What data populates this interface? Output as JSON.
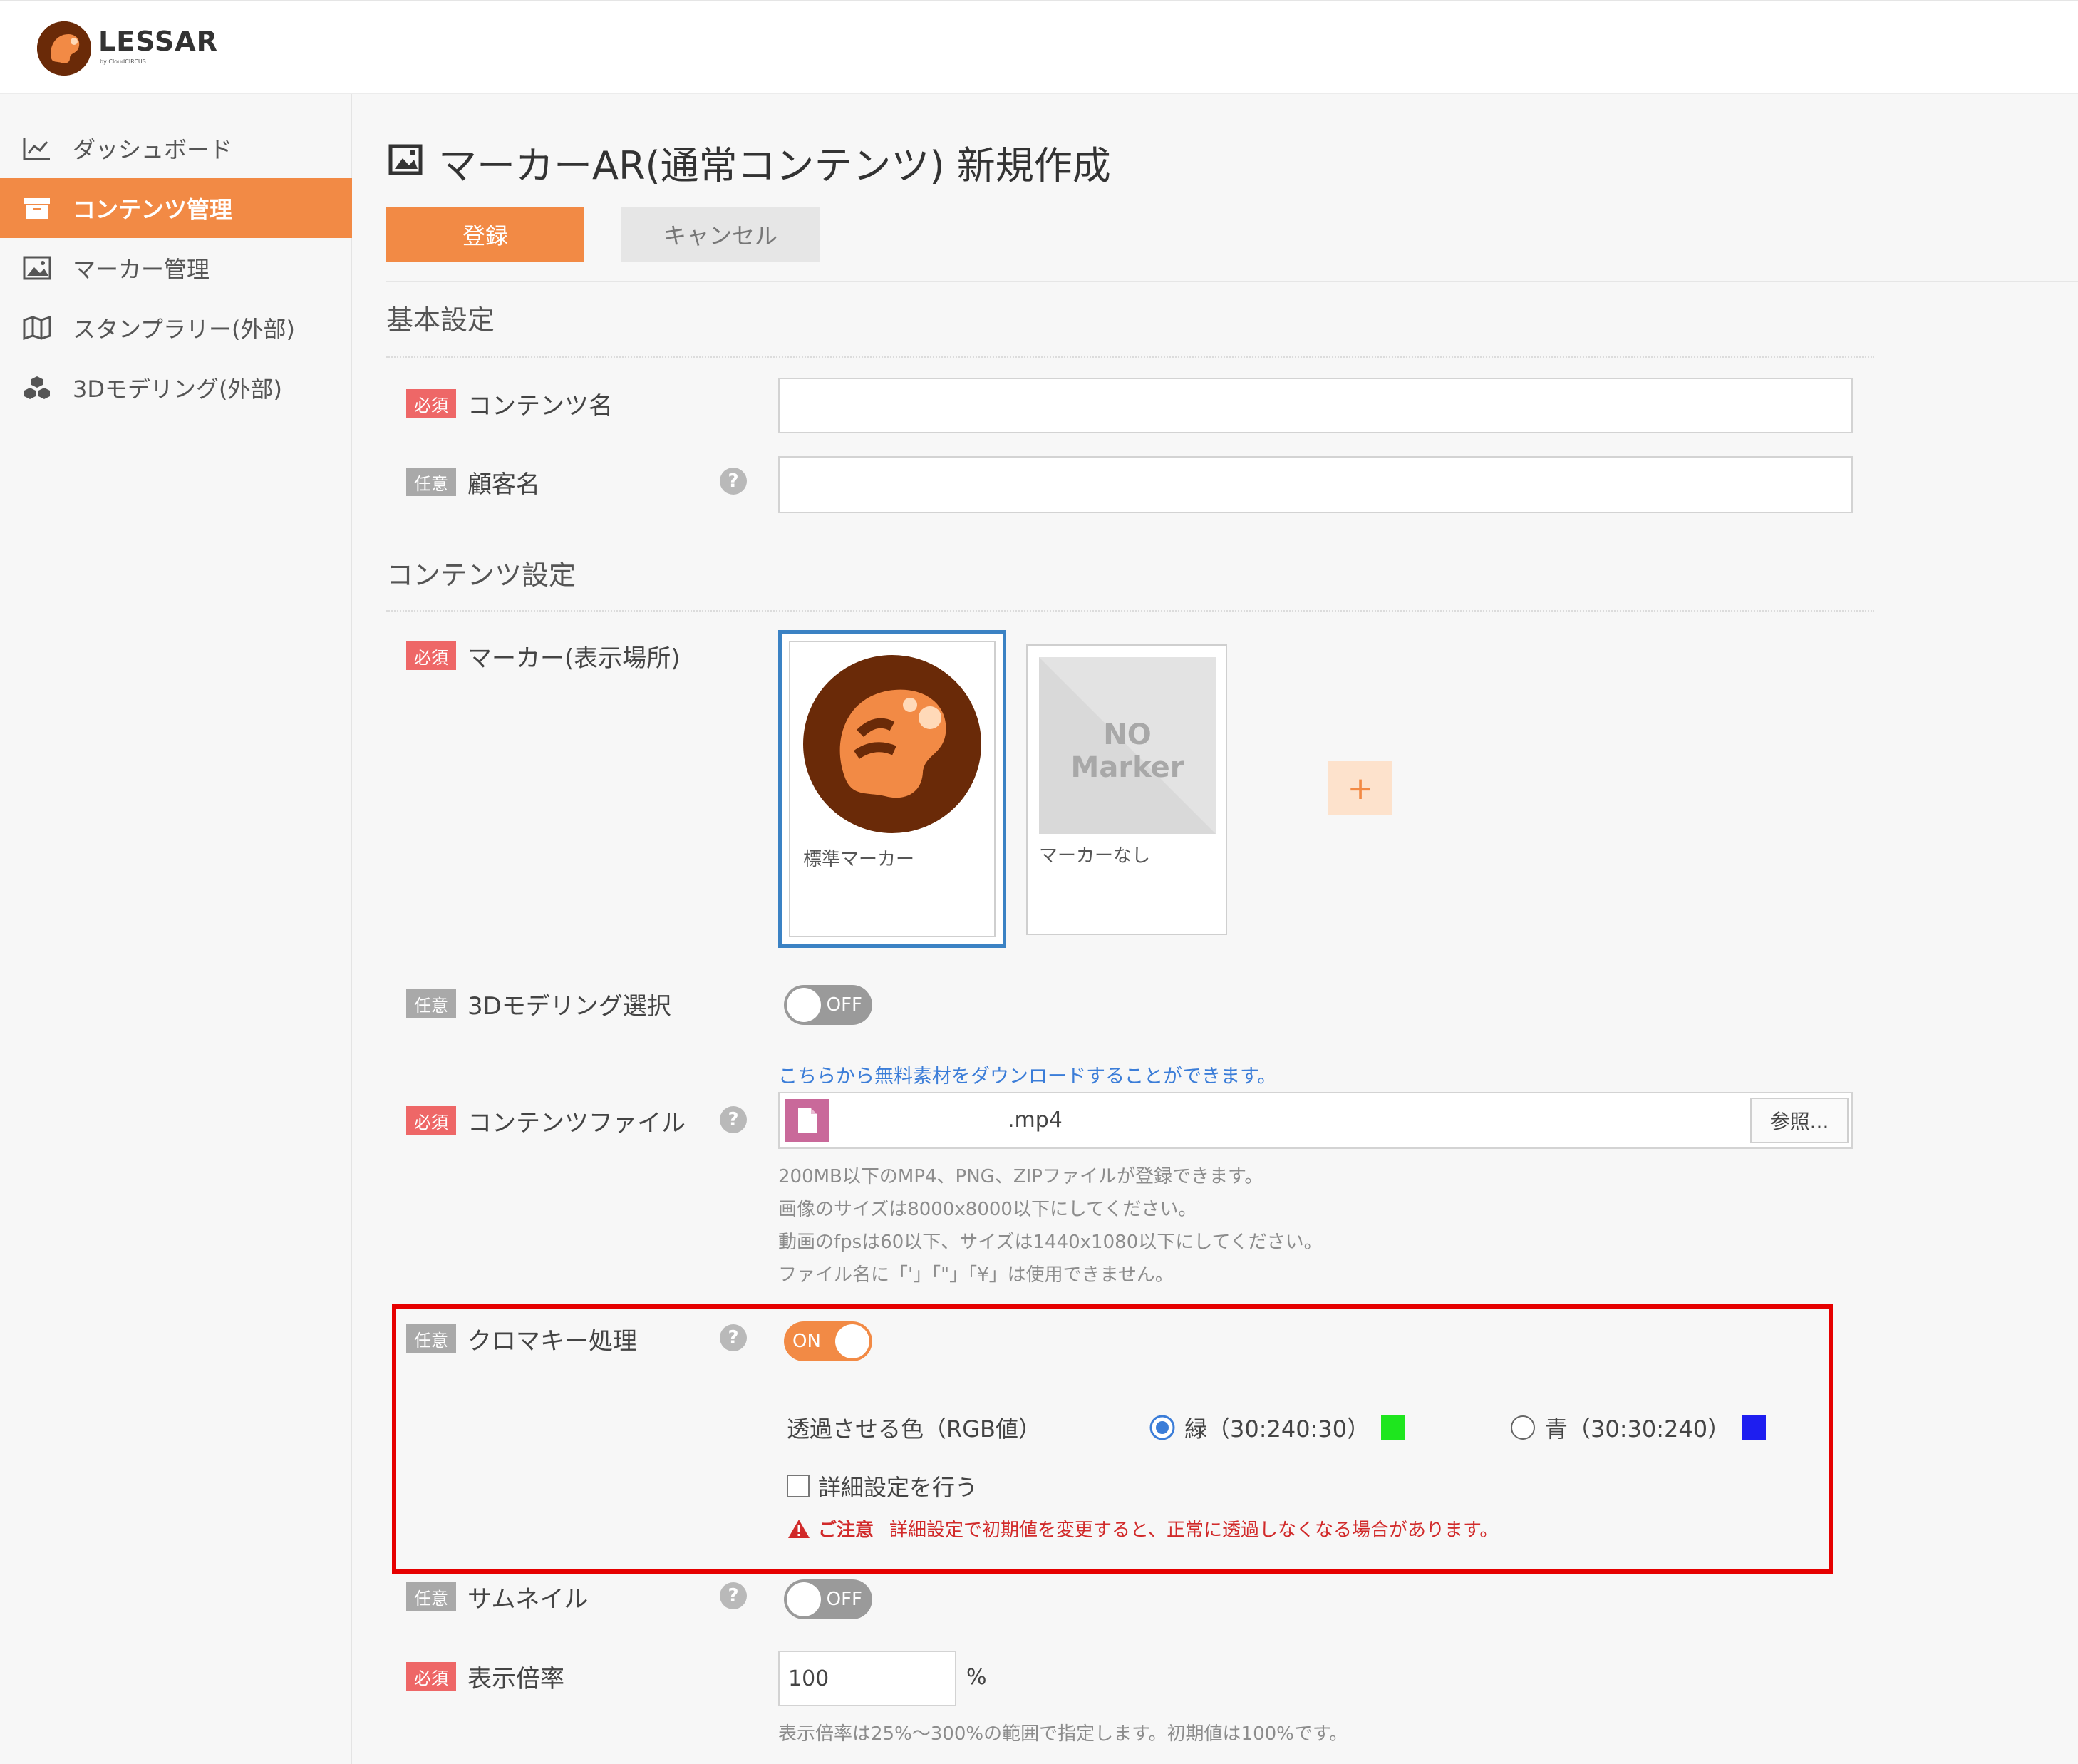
{
  "app": {
    "logo_text": "LESSAR",
    "logo_sub": "by CloudCIRCUS"
  },
  "sidebar": {
    "items": [
      {
        "label": "ダッシュボード",
        "icon": "chart-line-icon"
      },
      {
        "label": "コンテンツ管理",
        "icon": "archive-box-icon",
        "active": true
      },
      {
        "label": "マーカー管理",
        "icon": "image-icon"
      },
      {
        "label": "スタンプラリー(外部)",
        "icon": "map-icon"
      },
      {
        "label": "3Dモデリング(外部)",
        "icon": "cubes-icon"
      }
    ]
  },
  "page": {
    "title": "マーカーAR(通常コンテンツ) 新規作成",
    "register_button": "登録",
    "cancel_button": "キャンセル"
  },
  "basic": {
    "section_title": "基本設定",
    "content_name": {
      "badge": "必須",
      "label": "コンテンツ名",
      "value": ""
    },
    "customer_name": {
      "badge": "任意",
      "label": "顧客名",
      "value": ""
    }
  },
  "content": {
    "section_title": "コンテンツ設定",
    "marker": {
      "badge": "必須",
      "label": "マーカー(表示場所)",
      "cards": [
        {
          "caption": "標準マーカー",
          "selected": true
        },
        {
          "caption": "マーカーなし",
          "placeholder_line1": "NO",
          "placeholder_line2": "Marker"
        }
      ],
      "add_button": "+"
    },
    "model3d": {
      "badge": "任意",
      "label": "3Dモデリング選択",
      "toggle": "OFF"
    },
    "file": {
      "download_link": "こちらから無料素材をダウンロードすることができます。",
      "badge": "必須",
      "label": "コンテンツファイル",
      "filename": ".mp4",
      "browse_button": "参照...",
      "notes": [
        "200MB以下のMP4、PNG、ZIPファイルが登録できます。",
        "画像のサイズは8000x8000以下にしてください。",
        "動画のfpsは60以下、サイズは1440x1080以下にしてください。",
        "ファイル名に「'」「\"」「¥」は使用できません。"
      ]
    },
    "chroma": {
      "badge": "任意",
      "label": "クロマキー処理",
      "toggle": "ON",
      "color_label": "透過させる色（RGB値）",
      "options": [
        {
          "label": "緑（30:240:30）",
          "color": "#1ee61e",
          "checked": true
        },
        {
          "label": "青（30:30:240）",
          "color": "#1e1ef0",
          "checked": false
        }
      ],
      "advanced_label": "詳細設定を行う",
      "warning_title": "ご注意",
      "warning_text": "詳細設定で初期値を変更すると、正常に透過しなくなる場合があります。"
    },
    "thumbnail": {
      "badge": "任意",
      "label": "サムネイル",
      "toggle": "OFF"
    },
    "scale": {
      "badge": "必須",
      "label": "表示倍率",
      "value": "100",
      "unit": "%",
      "note": "表示倍率は25%～300%の範囲で指定します。初期値は100%です。"
    }
  },
  "colors": {
    "accent": "#f28a45",
    "required": "#ee6767",
    "optional": "#a9a9a9",
    "highlight": "#e60000",
    "link": "#3b7dd8"
  }
}
